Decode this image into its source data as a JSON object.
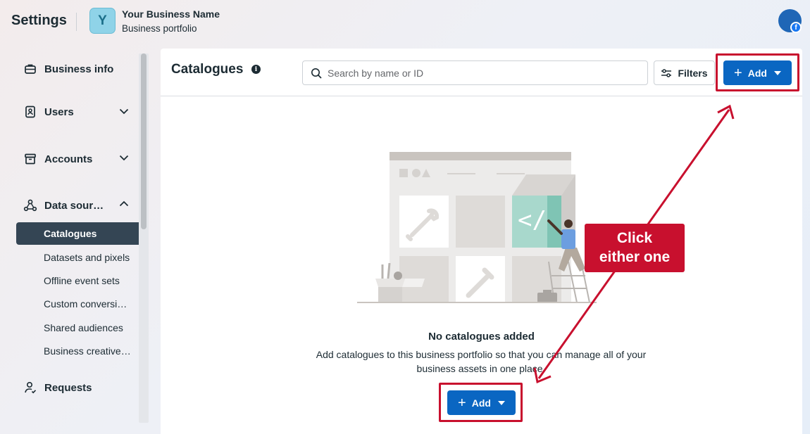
{
  "header": {
    "title": "Settings",
    "business_initial": "Y",
    "business_name": "Your Business Name",
    "business_subtitle": "Business portfolio"
  },
  "sidebar": {
    "items": [
      {
        "label": "Business info",
        "icon": "briefcase-icon"
      },
      {
        "label": "Users",
        "icon": "id-badge-icon",
        "expandable": true
      },
      {
        "label": "Accounts",
        "icon": "archive-box-icon",
        "expandable": true
      },
      {
        "label": "Data sour…",
        "icon": "data-nodes-icon",
        "expanded": true
      },
      {
        "label": "Requests",
        "icon": "person-check-icon"
      }
    ],
    "data_sources_children": [
      {
        "label": "Catalogues",
        "active": true
      },
      {
        "label": "Datasets and pixels"
      },
      {
        "label": "Offline event sets"
      },
      {
        "label": "Custom conversi…"
      },
      {
        "label": "Shared audiences"
      },
      {
        "label": "Business creative…"
      }
    ]
  },
  "main": {
    "title": "Catalogues",
    "search_placeholder": "Search by name or ID",
    "filters_label": "Filters",
    "add_label": "Add",
    "empty_title": "No catalogues added",
    "empty_description": "Add catalogues to this business portfolio so that you can manage all of your business assets in one place."
  },
  "annotation": {
    "callout_line1": "Click",
    "callout_line2": "either one"
  },
  "colors": {
    "primary_button": "#0a66c2",
    "annotation_red": "#c8102e",
    "active_nav": "#344554"
  }
}
